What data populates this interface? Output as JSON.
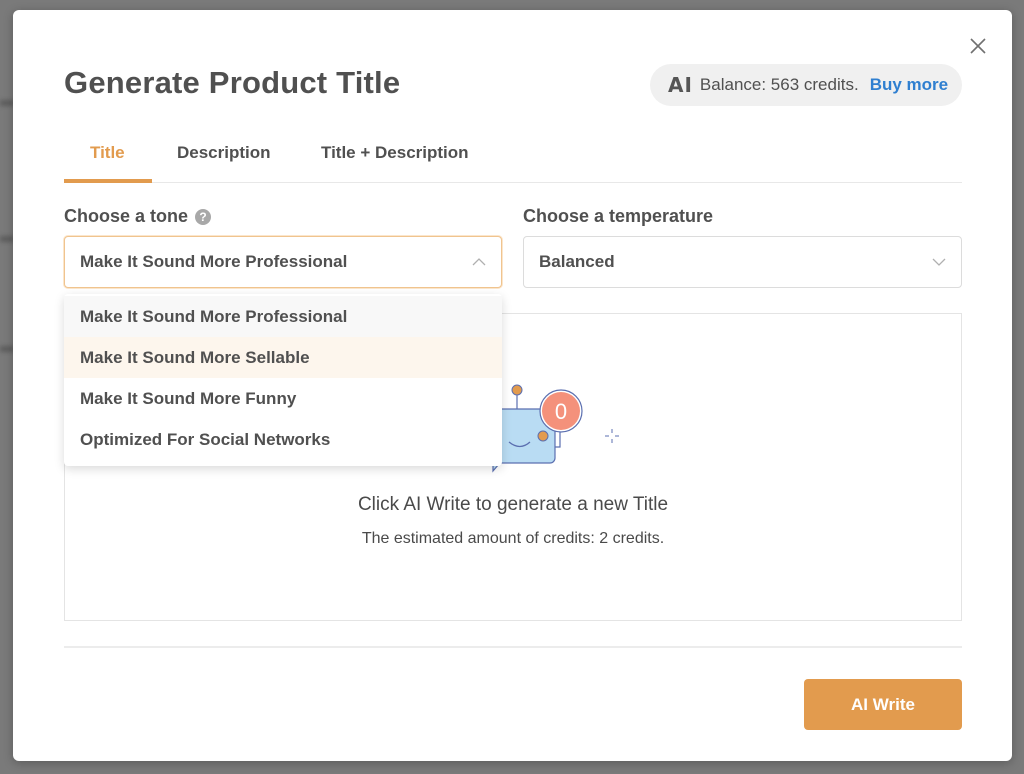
{
  "modal": {
    "title": "Generate Product Title",
    "close_icon": "close-icon"
  },
  "balance": {
    "logo_text": "AI",
    "text": "Balance: 563 credits.",
    "credits": 563,
    "buy_more_label": "Buy more"
  },
  "tabs": [
    {
      "label": "Title",
      "active": true
    },
    {
      "label": "Description",
      "active": false
    },
    {
      "label": "Title + Description",
      "active": false
    }
  ],
  "tone": {
    "label": "Choose a tone",
    "help_icon": "?",
    "selected": "Make It Sound More Professional",
    "open": true,
    "options": [
      {
        "label": "Make It Sound More Professional",
        "state": "selected"
      },
      {
        "label": "Make It Sound More Sellable",
        "state": "hover"
      },
      {
        "label": "Make It Sound More Funny",
        "state": "normal"
      },
      {
        "label": "Optimized For Social Networks",
        "state": "normal"
      }
    ]
  },
  "temperature": {
    "label": "Choose a temperature",
    "selected": "Balanced"
  },
  "result": {
    "badge_count": "0",
    "heading": "Click AI Write to generate a new Title",
    "subtext": "The estimated amount of credits: 2 credits."
  },
  "actions": {
    "ai_write_label": "AI Write"
  },
  "colors": {
    "accent": "#e29b4e",
    "link": "#2f7fd0",
    "text": "#505050",
    "badge": "#f4917b",
    "robot": "#b9dcf3"
  }
}
